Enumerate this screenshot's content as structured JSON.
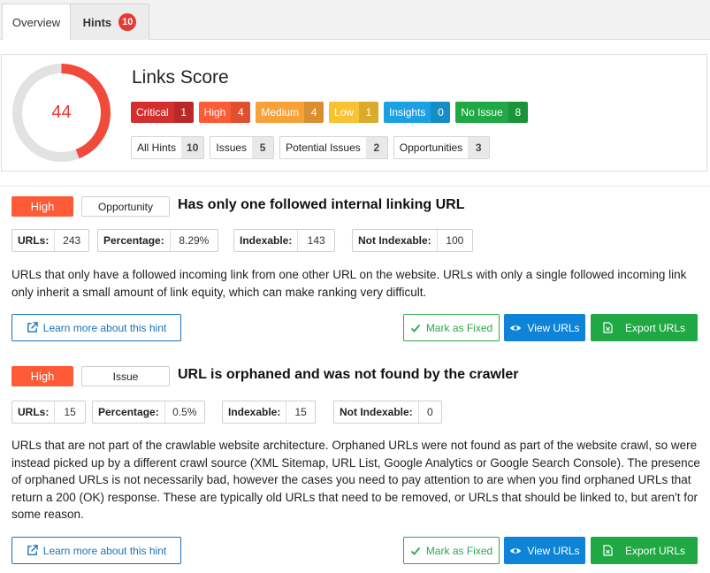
{
  "tabs": [
    {
      "label": "Overview"
    },
    {
      "label": "Hints",
      "badge": "10"
    }
  ],
  "score": {
    "title": "Links Score",
    "value": "44",
    "fraction": 0.44,
    "gauge_color": "#f24a3a",
    "track_color": "#e2e2e2"
  },
  "severity": [
    {
      "label": "Critical",
      "count": "1",
      "color": "#d32f2f"
    },
    {
      "label": "High",
      "count": "4",
      "color": "#ff5a36"
    },
    {
      "label": "Medium",
      "count": "4",
      "color": "#f7a238"
    },
    {
      "label": "Low",
      "count": "1",
      "color": "#f9c232"
    },
    {
      "label": "Insights",
      "count": "0",
      "color": "#1ba1e2"
    },
    {
      "label": "No Issue",
      "count": "8",
      "color": "#1fa843"
    }
  ],
  "categories": [
    {
      "label": "All Hints",
      "count": "10"
    },
    {
      "label": "Issues",
      "count": "5"
    },
    {
      "label": "Potential Issues",
      "count": "2"
    },
    {
      "label": "Opportunities",
      "count": "3"
    }
  ],
  "hints": [
    {
      "priority": "High",
      "type": "Opportunity",
      "title": "Has only one followed internal linking URL",
      "stats": [
        {
          "key": "URLs:",
          "value": "243"
        },
        {
          "key": "Percentage:",
          "value": "8.29%"
        },
        {
          "key": "Indexable:",
          "value": "143"
        },
        {
          "key": "Not Indexable:",
          "value": "100"
        }
      ],
      "description": "URLs that only have a followed incoming link from one other URL on the website. URLs with only a single followed incoming link only inherit a small amount of link equity, which can make ranking very difficult.",
      "learn_label": "Learn more about this hint",
      "fixed_label": "Mark as Fixed",
      "view_label": "View URLs",
      "export_label": "Export URLs"
    },
    {
      "priority": "High",
      "type": "Issue",
      "title": "URL is orphaned and was not found by the crawler",
      "stats": [
        {
          "key": "URLs:",
          "value": "15"
        },
        {
          "key": "Percentage:",
          "value": "0.5%"
        },
        {
          "key": "Indexable:",
          "value": "15"
        },
        {
          "key": "Not Indexable:",
          "value": "0"
        }
      ],
      "description": "URLs that are not part of the crawlable website architecture. Orphaned URLs were not found as part of the website crawl, so were instead picked up by a different crawl source (XML Sitemap, URL List, Google Analytics or Google Search Console). The presence of orphaned URLs is not necessarily bad, however the cases you need to pay attention to are when you find orphaned URLs that return a 200 (OK) response. These are typically old URLs that need to be removed, or URLs that should be linked to, but aren't for some reason.",
      "learn_label": "Learn more about this hint",
      "fixed_label": "Mark as Fixed",
      "view_label": "View URLs",
      "export_label": "Export URLs"
    }
  ],
  "icons": {
    "learn": "external-link-icon",
    "fixed": "check-icon",
    "view": "eye-icon",
    "export": "file-excel-icon"
  }
}
